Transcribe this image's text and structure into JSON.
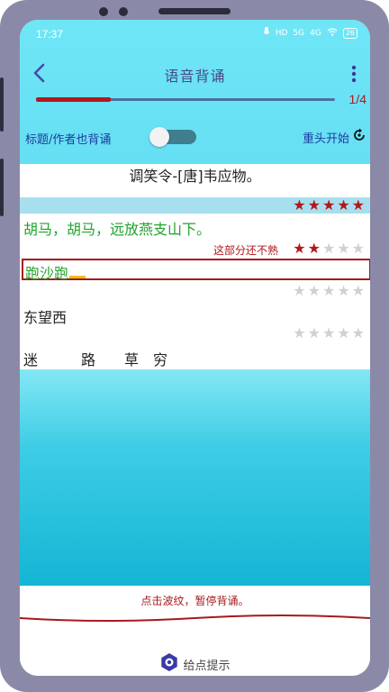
{
  "status_bar": {
    "time": "17:37",
    "icons": [
      "mic-icon",
      "hd-icon",
      "5g-signal-icon",
      "4g-signal-icon",
      "wifi-icon",
      "battery-icon"
    ],
    "hd_text": "HD",
    "signal1_text": "5G",
    "signal2_text": "4G",
    "battery_text": "26"
  },
  "header": {
    "title": "语音背诵",
    "progress_text": "1/4",
    "progress_fraction": 0.25
  },
  "options": {
    "title_author_label": "标题/作者也背诵",
    "title_author_toggle_on": false,
    "restart_label": "重头开始"
  },
  "poem": {
    "title": "调笑令-[唐]韦应物。",
    "title_stars": 5,
    "lines": [
      {
        "text": "胡马，胡马，远放燕支山下。",
        "stars": 2,
        "note": "这部分还不熟",
        "color": "#21a32c"
      },
      {
        "input": "跑沙跑",
        "stars": 0
      },
      {
        "text": "东望西",
        "stars": 0,
        "color": "#222222"
      },
      {
        "text": "迷　　　路　　草　穷",
        "stars": 0,
        "color": "#222222"
      }
    ]
  },
  "bottom": {
    "pause_hint": "点击波纹，暂停背诵。",
    "tip_label": "给点提示"
  },
  "colors": {
    "accent_red": "#b3171c",
    "accent_blue": "#1d3a9e",
    "header_cyan": "#66dff4",
    "green_text": "#21a32c"
  }
}
